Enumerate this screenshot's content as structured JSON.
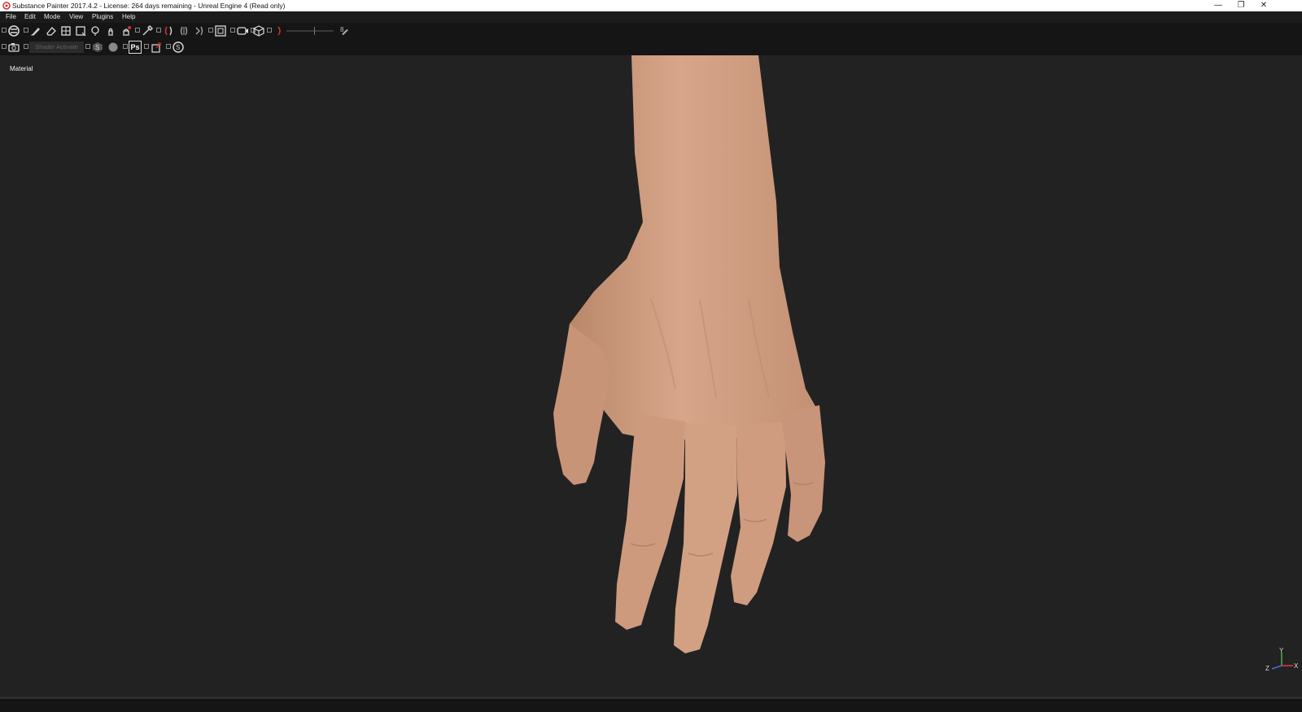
{
  "window": {
    "title": "Substance Painter 2017.4.2 - License: 264 days remaining - Unreal Engine 4 (Read only)",
    "minimize_glyph": "—",
    "restore_glyph": "❐",
    "close_glyph": "✕"
  },
  "menu": {
    "items": [
      "File",
      "Edit",
      "Mode",
      "View",
      "Plugins",
      "Help"
    ]
  },
  "toolbar": {
    "tools": [
      "paint-mode-icon",
      "paint-brush-icon",
      "eraser-icon",
      "projection-icon",
      "polygon-fill-icon",
      "smudge-icon",
      "clone-icon",
      "clone-stamp-icon",
      "color-picker-icon",
      "mirror-x-icon",
      "mirror-y-icon",
      "mirror-z-icon",
      "symmetry-icon",
      "camera-settings-icon",
      "display-settings-icon",
      "lazy-mouse-icon"
    ],
    "slider_value": "8",
    "shader_placeholder": "Shader Activate"
  },
  "toolbar2": {
    "icons": [
      "screenshot-icon",
      "substance-icon",
      "sphere-icon",
      "photoshop-icon",
      "export-icon",
      "share-icon"
    ],
    "photoshop_label": "Ps"
  },
  "viewport": {
    "label": "Material",
    "axis_labels": {
      "x": "X",
      "y": "Y",
      "z": "Z"
    }
  },
  "colors": {
    "viewport_bg": "#222222",
    "skin": "#d4a183",
    "skin_shadow": "#b07e62",
    "toolbar_bg": "#151515"
  }
}
